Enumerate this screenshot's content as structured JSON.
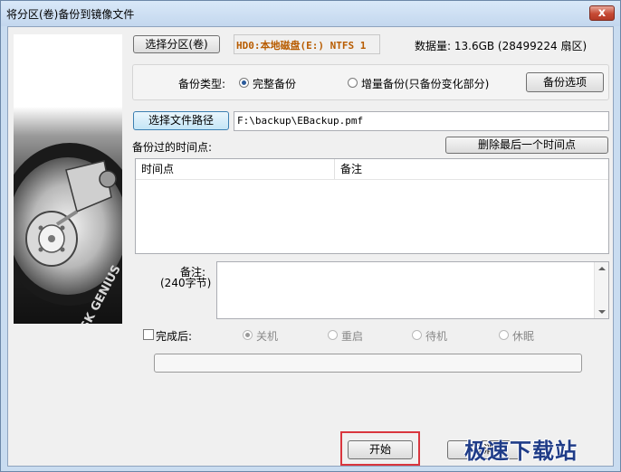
{
  "window": {
    "title": "将分区(卷)备份到镜像文件",
    "close": "x"
  },
  "partition": {
    "select_button": "选择分区(卷)",
    "selected": "HD0:本地磁盘(E:) NTFS 1",
    "size_info": "数据量: 13.6GB (28499224 扇区)"
  },
  "backup_type": {
    "label": "备份类型:",
    "full": "完整备份",
    "incremental": "增量备份(只备份变化部分)",
    "options_button": "备份选项"
  },
  "path": {
    "select_button": "选择文件路径",
    "value": "F:\\backup\\EBackup.pmf"
  },
  "timepoints": {
    "label": "备份过的时间点:",
    "delete_button": "删除最后一个时间点",
    "columns": [
      "时间点",
      "备注"
    ],
    "rows": []
  },
  "note": {
    "label": "备注:",
    "sublabel": "(240字节)",
    "value": ""
  },
  "after": {
    "label": "完成后:",
    "options": [
      "关机",
      "重启",
      "待机",
      "休眠"
    ],
    "selected": "关机"
  },
  "progress": {
    "value": 0
  },
  "actions": {
    "start": "开始",
    "cancel": "取消"
  },
  "logo": {
    "text": "DISK GENIUS"
  },
  "watermark": {
    "text": "极速下载站"
  },
  "colors": {
    "highlight_border": "#d9363e",
    "partition_text": "#b85c00"
  }
}
